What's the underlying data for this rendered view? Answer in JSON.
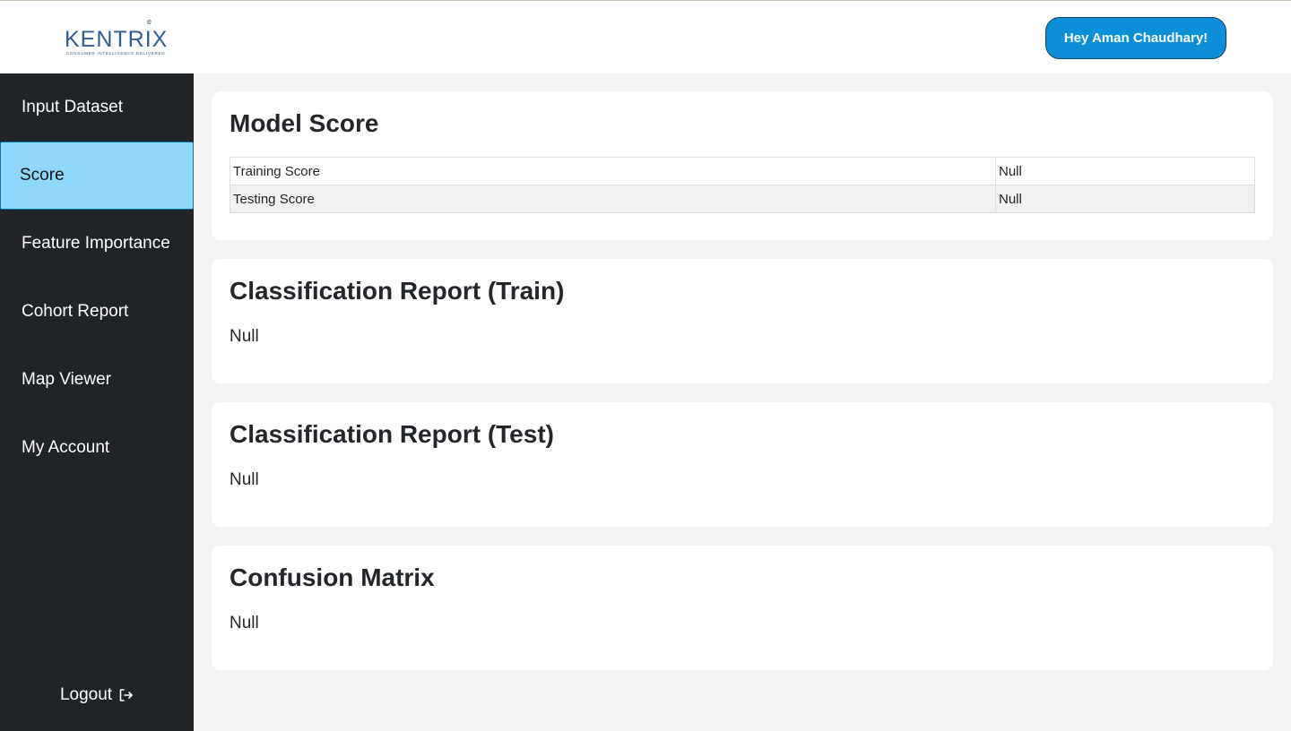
{
  "header": {
    "logo_text": "KENTRIX",
    "logo_tagline": "CONSUMER INTELLIGENCE DELIVERED",
    "user_greeting": "Hey Aman Chaudhary!"
  },
  "sidebar": {
    "items": [
      {
        "label": "Input Dataset",
        "active": false
      },
      {
        "label": "Score",
        "active": true
      },
      {
        "label": "Feature Importance",
        "active": false
      },
      {
        "label": "Cohort Report",
        "active": false
      },
      {
        "label": "Map Viewer",
        "active": false
      },
      {
        "label": "My Account",
        "active": false
      }
    ],
    "logout_label": "Logout",
    "logout_icon": "logout-icon"
  },
  "model_score": {
    "title": "Model Score",
    "rows": [
      {
        "label": "Training Score",
        "value": "Null"
      },
      {
        "label": "Testing Score",
        "value": "Null"
      }
    ]
  },
  "classification_train": {
    "title": "Classification Report (Train)",
    "value": "Null"
  },
  "classification_test": {
    "title": "Classification Report (Test)",
    "value": "Null"
  },
  "confusion_matrix": {
    "title": "Confusion Matrix",
    "value": "Null"
  },
  "colors": {
    "sidebar_bg": "#202428",
    "active_item_bg": "#8fd6fa",
    "accent": "#0b8fd8",
    "page_bg": "#f3f3f3"
  }
}
